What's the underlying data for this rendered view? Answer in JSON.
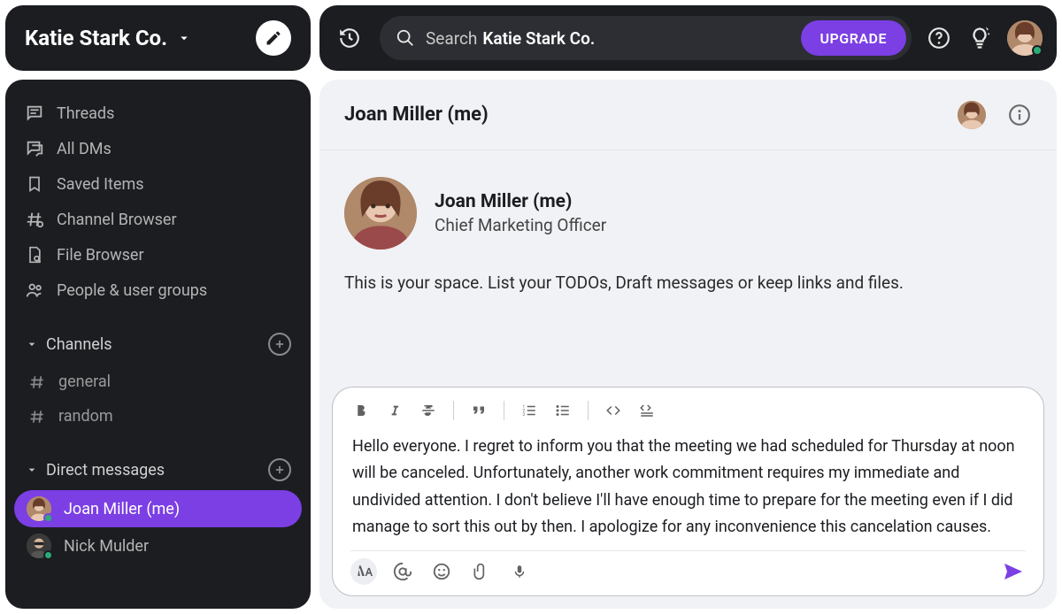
{
  "workspace": {
    "name": "Katie Stark Co."
  },
  "sidebar": {
    "nav": [
      {
        "label": "Threads",
        "icon": "threads-icon"
      },
      {
        "label": "All DMs",
        "icon": "dms-icon"
      },
      {
        "label": "Saved Items",
        "icon": "bookmark-icon"
      },
      {
        "label": "Channel Browser",
        "icon": "channel-browser-icon"
      },
      {
        "label": "File Browser",
        "icon": "file-browser-icon"
      },
      {
        "label": "People & user groups",
        "icon": "people-icon"
      }
    ],
    "channels_label": "Channels",
    "channels": [
      {
        "label": "general"
      },
      {
        "label": "random"
      }
    ],
    "dms_label": "Direct messages",
    "dms": [
      {
        "label": "Joan Miller (me)",
        "active": true,
        "presence": "online"
      },
      {
        "label": "Nick Mulder",
        "active": false,
        "presence": "online"
      }
    ]
  },
  "topbar": {
    "search_prefix": "Search",
    "search_bold": "Katie Stark Co.",
    "upgrade": "UPGRADE"
  },
  "channel": {
    "title": "Joan Miller (me)",
    "intro_name": "Joan Miller (me)",
    "intro_role": "Chief Marketing Officer",
    "intro_desc": "This is your space. List your TODOs, Draft messages or keep links and files."
  },
  "composer": {
    "text": "Hello everyone. I regret to inform you that the meeting we had scheduled for Thursday at noon will be canceled. Unfortunately, another work commitment requires my immediate and undivided attention. I don't believe I'll have enough time to prepare for the meeting even if I did manage to sort this out by then. I apologize for any inconvenience this cancelation causes."
  },
  "colors": {
    "accent": "#7b3fe4"
  }
}
